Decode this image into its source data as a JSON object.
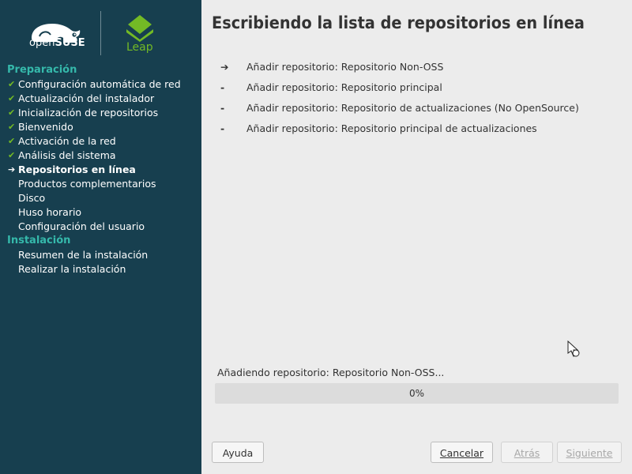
{
  "brand": {
    "suse_prefix": "open",
    "suse_name": "SUSE",
    "leap_label": "Leap",
    "accent": "#73ba25",
    "sidebar_bg": "#173f4f",
    "section_color": "#35b9ab"
  },
  "sidebar": {
    "sections": [
      {
        "title": "Preparación",
        "steps": [
          {
            "label": "Configuración automática de red",
            "state": "done"
          },
          {
            "label": "Actualización del instalador",
            "state": "done"
          },
          {
            "label": "Inicialización de repositorios",
            "state": "done"
          },
          {
            "label": "Bienvenido",
            "state": "done"
          },
          {
            "label": "Activación de la red",
            "state": "done"
          },
          {
            "label": "Análisis del sistema",
            "state": "done"
          },
          {
            "label": "Repositorios en línea",
            "state": "current"
          },
          {
            "label": "Productos complementarios",
            "state": "pending"
          },
          {
            "label": "Disco",
            "state": "pending"
          },
          {
            "label": "Huso horario",
            "state": "pending"
          },
          {
            "label": "Configuración del usuario",
            "state": "pending"
          }
        ]
      },
      {
        "title": "Instalación",
        "steps": [
          {
            "label": "Resumen de la instalación",
            "state": "pending"
          },
          {
            "label": "Realizar la instalación",
            "state": "pending"
          }
        ]
      }
    ]
  },
  "main": {
    "title": "Escribiendo la lista de repositorios en línea",
    "repos": [
      {
        "marker": "➔",
        "label": "Añadir repositorio: Repositorio Non-OSS"
      },
      {
        "marker": "-",
        "label": "Añadir repositorio: Repositorio principal"
      },
      {
        "marker": "-",
        "label": "Añadir repositorio: Repositorio de actualizaciones (No OpenSource)"
      },
      {
        "marker": "-",
        "label": "Añadir repositorio: Repositorio principal de actualizaciones"
      }
    ],
    "progress": {
      "label": "Añadiendo repositorio: Repositorio Non-OSS...",
      "value_text": "0%",
      "fraction": 0.0
    }
  },
  "buttons": {
    "help": {
      "label": "Ayuda",
      "enabled": true
    },
    "cancel": {
      "label": "Cancelar",
      "enabled": true
    },
    "back": {
      "label": "Atrás",
      "enabled": false
    },
    "next": {
      "label": "Siguiente",
      "enabled": false
    }
  }
}
